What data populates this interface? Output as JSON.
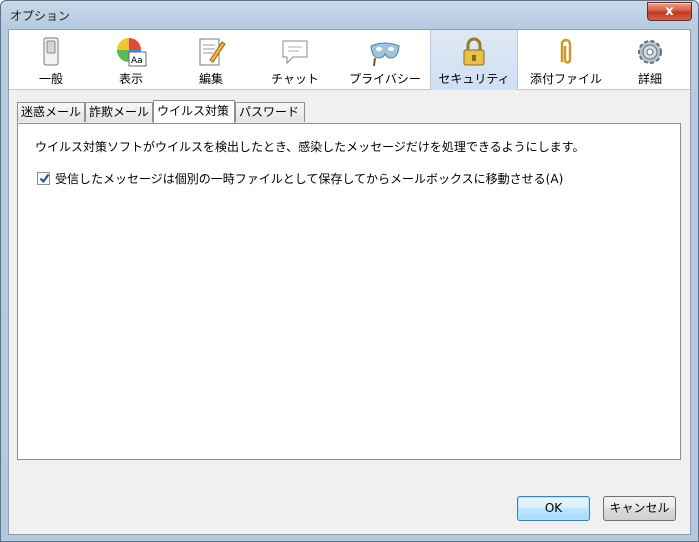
{
  "window": {
    "title": "オプション",
    "close_label": "x"
  },
  "toolbar": {
    "panes": [
      {
        "label": "一般",
        "icon": "switch-icon",
        "selected": false
      },
      {
        "label": "表示",
        "icon": "display-palette-icon",
        "selected": false
      },
      {
        "label": "編集",
        "icon": "compose-pencil-icon",
        "selected": false
      },
      {
        "label": "チャット",
        "icon": "chat-bubble-icon",
        "selected": false
      },
      {
        "label": "プライバシー",
        "icon": "privacy-mask-icon",
        "selected": false
      },
      {
        "label": "セキュリティ",
        "icon": "padlock-icon",
        "selected": true
      },
      {
        "label": "添付ファイル",
        "icon": "paperclip-icon",
        "selected": false
      },
      {
        "label": "詳細",
        "icon": "gear-icon",
        "selected": false
      }
    ]
  },
  "tabs": [
    {
      "label": "迷惑メール",
      "active": false
    },
    {
      "label": "詐欺メール",
      "active": false
    },
    {
      "label": "ウイルス対策",
      "active": true
    },
    {
      "label": "パスワード",
      "active": false
    }
  ],
  "antivirus": {
    "description": "ウイルス対策ソフトがウイルスを検出したとき、感染したメッセージだけを処理できるようにします。",
    "quarantine_checkbox": {
      "label": "受信したメッセージは個別の一時ファイルとして保存してからメールボックスに移動させる(A)",
      "checked": true
    }
  },
  "buttons": {
    "ok": "OK",
    "cancel": "キャンセル"
  },
  "colors": {
    "selected_pane_bg": "#cfdff1",
    "close_button": "#c2381f",
    "default_button_border": "#3c7fb1"
  }
}
